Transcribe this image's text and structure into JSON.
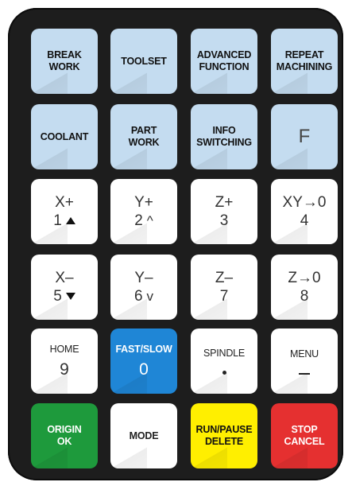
{
  "keypad": {
    "row1": {
      "break_work": "BREAK\nWORK",
      "toolset": "TOOLSET",
      "advanced_function": "ADVANCED\nFUNCTION",
      "repeat_machining": "REPEAT\nMACHINING"
    },
    "row2": {
      "coolant": "COOLANT",
      "part_work": "PART\nWORK",
      "info_switching": "INFO\nSWITCHING",
      "f": "F"
    },
    "row3": {
      "x_plus": "X+",
      "x_plus_sub": "1",
      "y_plus": "Y+",
      "y_plus_sub": "2",
      "y_plus_symbol": "^",
      "z_plus": "Z+",
      "z_plus_sub": "3",
      "xy_zero": "XY→0",
      "xy_zero_sub": "4"
    },
    "row4": {
      "x_minus": "X–",
      "x_minus_sub": "5",
      "y_minus": "Y–",
      "y_minus_sub": "6",
      "y_minus_symbol": "v",
      "z_minus": "Z–",
      "z_minus_sub": "7",
      "z_zero": "Z→0",
      "z_zero_sub": "8"
    },
    "row5": {
      "home": "HOME",
      "home_sub": "9",
      "fast_slow": "FAST/SLOW",
      "fast_slow_sub": "0",
      "spindle": "SPINDLE",
      "menu": "MENU"
    },
    "row6": {
      "origin_ok": "ORIGIN\nOK",
      "mode": "MODE",
      "run_pause_delete": "RUN/PAUSE\nDELETE",
      "stop_cancel": "STOP\nCANCEL"
    }
  },
  "colors": {
    "light_blue": "#c4dcf0",
    "blue": "#1f86d6",
    "green": "#1e9a3c",
    "yellow": "#ffef00",
    "red": "#e53030",
    "body": "#1d1d1d"
  },
  "icons": {
    "up_triangle": "up-triangle-icon",
    "down_triangle": "down-triangle-icon",
    "dot": "dot-icon",
    "dash": "dash-icon"
  }
}
